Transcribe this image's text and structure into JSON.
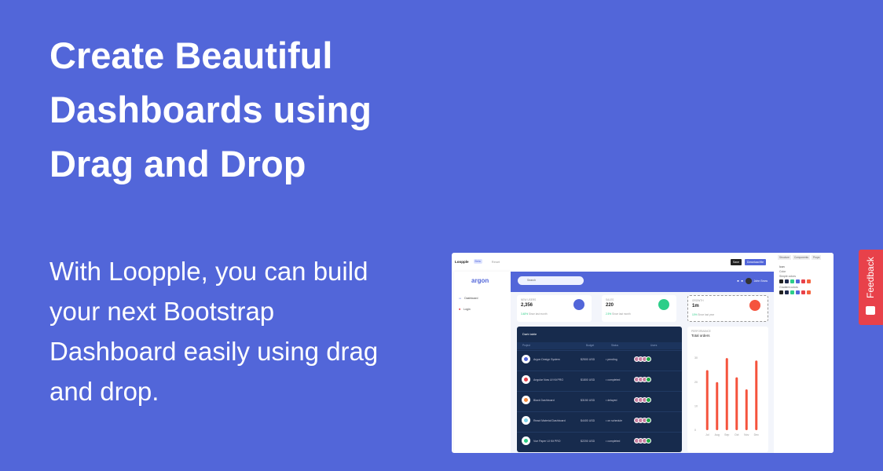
{
  "hero": {
    "title": "Create Beautiful Dashboards using Drag and Drop",
    "subtitle": "With Loopple, you can build your next Bootstrap Dashboard easily using drag and drop."
  },
  "preview": {
    "topbar": {
      "brand": "Loopple",
      "badge": "Beta",
      "edit": "Reset",
      "save": "Save",
      "download": "Download file"
    },
    "sidebar": {
      "logo": "argon",
      "items": [
        {
          "label": "Dashboard",
          "icon": "monitor-icon"
        },
        {
          "label": "Login",
          "icon": "lock-icon"
        }
      ]
    },
    "header": {
      "search_placeholder": "Search",
      "user": "John Snow"
    },
    "cards": [
      {
        "label": "NEW USERS",
        "value": "2,356",
        "delta": "3.48%",
        "since": "Since last month",
        "color": "#5266d9"
      },
      {
        "label": "SALES",
        "value": "220",
        "delta": "2.5%",
        "since": "Since last month",
        "color": "#2dce89"
      },
      {
        "label": "GROWTH",
        "value": "1m",
        "delta": "10%",
        "since": "Since last year",
        "color": "#f5533d"
      }
    ],
    "dark_table": {
      "title": "Dark table",
      "columns": [
        "Project",
        "Budget",
        "Status",
        "Users"
      ],
      "rows": [
        {
          "project": "Argon Design System",
          "budget": "$2500 USD",
          "status": "pending",
          "color": "#5266d9"
        },
        {
          "project": "Angular Now UI Kit PRO",
          "budget": "$1800 USD",
          "status": "completed",
          "color": "#e8414a"
        },
        {
          "project": "Black Dashboard",
          "budget": "$3150 USD",
          "status": "delayed",
          "color": "#f58a3d"
        },
        {
          "project": "React Material Dashboard",
          "budget": "$4400 USD",
          "status": "on schedule",
          "color": "#7dd3ea"
        },
        {
          "project": "Vue Paper UI Kit PRO",
          "budget": "$2200 USD",
          "status": "completed",
          "color": "#2dce89"
        }
      ]
    },
    "right_panel": {
      "tabs": [
        "Structure",
        "Components",
        "Props"
      ],
      "labels": [
        "Icon",
        "Color",
        "Simple colors",
        "Gradient colors"
      ],
      "colors": [
        "#222222",
        "#1f2a4d",
        "#2dce89",
        "#5266d9",
        "#e8414a",
        "#f5633d"
      ]
    }
  },
  "chart_data": {
    "type": "bar",
    "subtitle": "PERFORMANCE",
    "title": "Total orders",
    "categories": [
      "Jul",
      "Aug",
      "Sep",
      "Oct",
      "Nov",
      "Dec"
    ],
    "values": [
      25,
      20,
      30,
      22,
      17,
      29
    ],
    "yticks": [
      0,
      10,
      20,
      30
    ],
    "ylim": [
      0,
      32
    ],
    "color": "#f5533d"
  },
  "feedback": {
    "label": "Feedback"
  }
}
